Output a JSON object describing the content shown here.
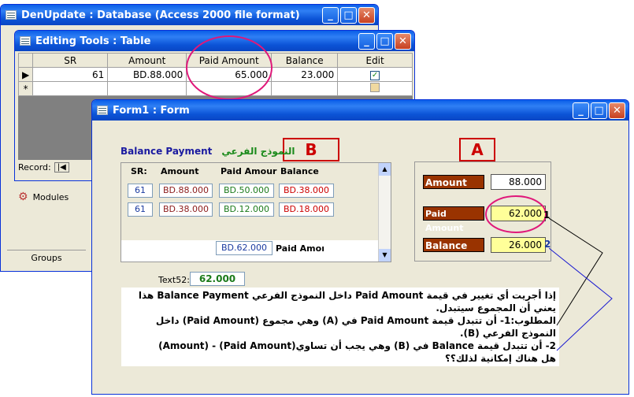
{
  "win_db": {
    "title": "DenUpdate : Database (Access 2000 file format)"
  },
  "win_tools": {
    "title": "Editing Tools : Table",
    "headers": [
      "SR",
      "Amount",
      "Paid Amount",
      "Balance",
      "Edit"
    ],
    "row": [
      "61",
      "BD.88.000",
      "65.000",
      "23.000"
    ],
    "record_label": "Record:"
  },
  "db_side": {
    "modules": "Modules",
    "groups": "Groups"
  },
  "form": {
    "title": "Form1 : Form",
    "label_b": "B",
    "label_a": "A",
    "sub_title": "Balance Payment",
    "sub_title_ar": "النموذج الفرعي",
    "sub_headers": [
      "SR:",
      "Amount",
      "Paid Amour",
      "Balance"
    ],
    "sub_rows": [
      [
        "61",
        "BD.88.000",
        "BD.50.000",
        "BD.38.000"
      ],
      [
        "61",
        "BD.38.000",
        "BD.12.000",
        "BD.18.000"
      ]
    ],
    "sub_total": "BD.62.000",
    "sub_total_label": "Paid Amoı",
    "text52_label": "Text52:",
    "text52_value": "62.000",
    "amount_label": "Amount",
    "amount_value": "88.000",
    "paid_label": "Paid Amount",
    "paid_value": "62.000",
    "bal_label": "Balance",
    "bal_value": "26.000",
    "mark1": "1",
    "mark2": "2",
    "note_lines": [
      "إذا أجريت أي تغيير في قيمة Paid Amount داخل النموذج الفرعي Balance Payment هذا",
      "يعني أن المجموع سيتبدل.",
      "المطلوب:1- أن تتبدل قيمة Paid Amount في (A) وهي مجموع (Paid Amount) داخل",
      "النموذج الفرعي (B).",
      "2- أن تتبدل قيمة Balance في (B) وهي يجب أن تساوي(Paid Amount) - (Amount)",
      "هل هناك إمكانية لذلك؟؟"
    ]
  },
  "colors": {
    "accent": "#0a5ee8",
    "label_bg": "#993300",
    "highlight": "#ffff99",
    "annot": "#e0187a"
  }
}
